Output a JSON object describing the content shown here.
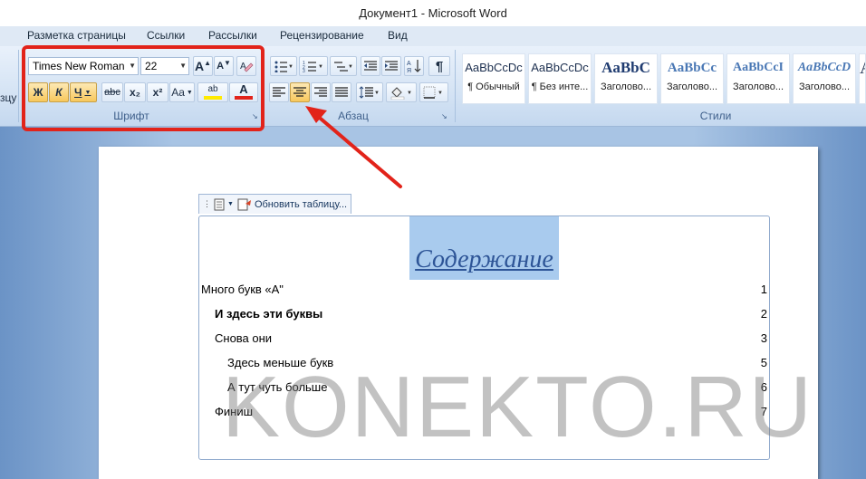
{
  "window": {
    "title": "Документ1 - Microsoft Word"
  },
  "tabs": [
    "Разметка страницы",
    "Ссылки",
    "Рассылки",
    "Рецензирование",
    "Вид"
  ],
  "left_edge_label": "зцу",
  "font_group": {
    "label": "Шрифт",
    "font_name": "Times New Roman",
    "font_size": "22",
    "bold": "Ж",
    "italic": "К",
    "underline": "Ч",
    "strike": "abc",
    "subscript": "x₂",
    "superscript": "x²",
    "change_case": "Aa",
    "grow": "A",
    "shrink": "A",
    "font_color_letter": "A",
    "highlight_letter": "ab",
    "highlight_color": "#ffea00",
    "font_color": "#e2231a"
  },
  "paragraph_group": {
    "label": "Абзац"
  },
  "styles_group": {
    "label": "Стили",
    "items": [
      {
        "sample": "AaBbCcDc",
        "name": "¶ Обычный"
      },
      {
        "sample": "AaBbCcDc",
        "name": "¶ Без инте..."
      },
      {
        "sample": "AaBbC",
        "name": "Заголово..."
      },
      {
        "sample": "AaBbCc",
        "name": "Заголово..."
      },
      {
        "sample": "AaBbCcI",
        "name": "Заголово..."
      },
      {
        "sample": "AaBbCcD",
        "name": "Заголово..."
      },
      {
        "sample": "A",
        "name": ""
      }
    ]
  },
  "toc": {
    "update_label": "Обновить таблицу...",
    "title": "Содержание",
    "entries": [
      {
        "text": "Много букв «А\"",
        "page": "1"
      },
      {
        "text": "И здесь эти буквы",
        "page": "2"
      },
      {
        "text": "Снова они",
        "page": "3"
      },
      {
        "text": "Здесь меньше букв",
        "page": "5"
      },
      {
        "text": "А тут чуть больше",
        "page": "6"
      },
      {
        "text": "Финиш",
        "page": "7"
      }
    ]
  },
  "watermark": "KONEKTO.RU",
  "annotation_color": "#e2231a"
}
